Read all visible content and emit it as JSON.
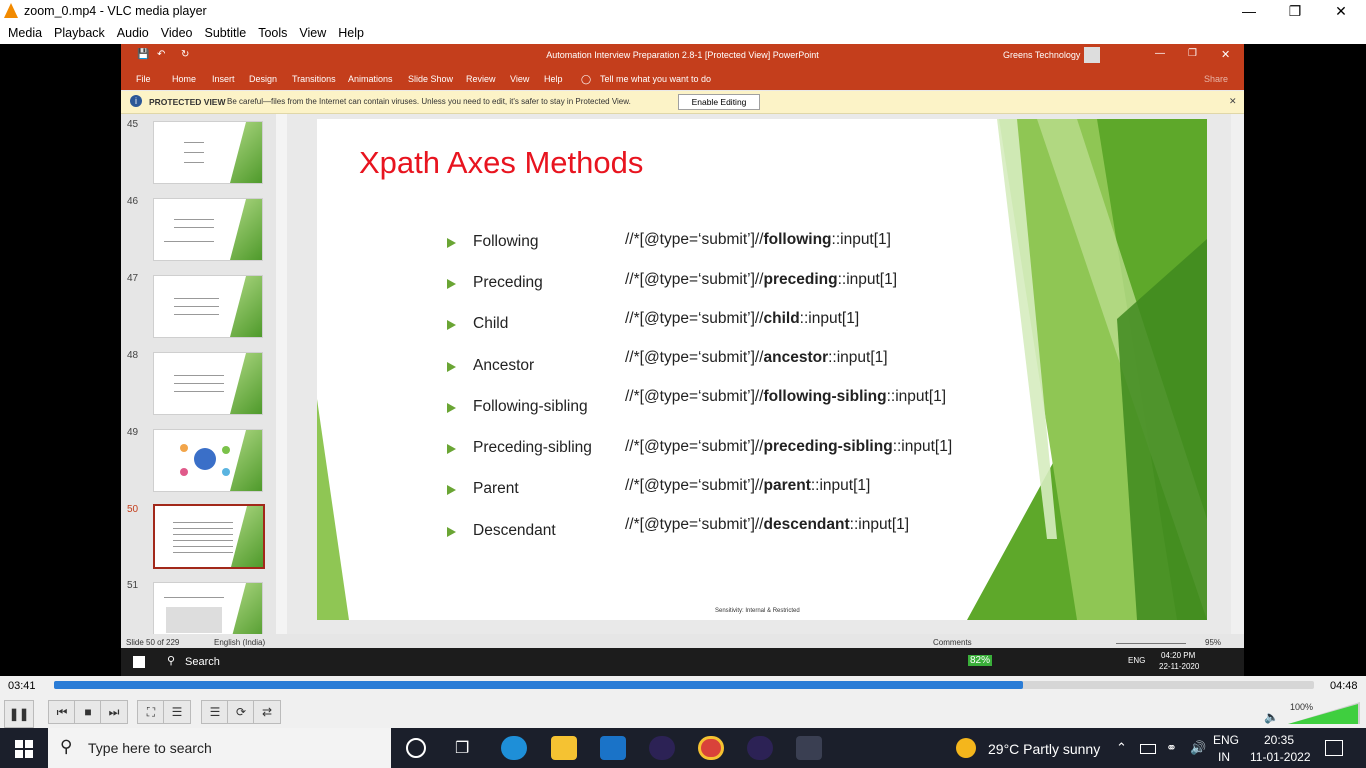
{
  "vlc": {
    "title": "zoom_0.mp4 - VLC media player",
    "menu": [
      "Media",
      "Playback",
      "Audio",
      "Video",
      "Subtitle",
      "Tools",
      "View",
      "Help"
    ],
    "time_elapsed": "03:41",
    "time_total": "04:48",
    "progress_fraction": 0.769,
    "volume": "100%"
  },
  "ppt": {
    "window_title": "Automation Interview Preparation 2.8-1 [Protected View]  PowerPoint",
    "user": "Greens Technology",
    "ribbon_tabs": [
      "File",
      "Home",
      "Insert",
      "Design",
      "Transitions",
      "Animations",
      "Slide Show",
      "Review",
      "View",
      "Help"
    ],
    "tell_me": "Tell me what you want to do",
    "share": "Share",
    "protected_label": "PROTECTED VIEW",
    "protected_msg": "Be careful—files from the Internet can contain viruses. Unless you need to edit, it's safer to stay in Protected View.",
    "enable_editing": "Enable Editing",
    "thumb_numbers": [
      "45",
      "46",
      "47",
      "48",
      "49",
      "50",
      "51"
    ],
    "status_slide": "Slide 50 of 229",
    "status_lang": "English (India)",
    "status_comments": "Comments",
    "zoom": "95%"
  },
  "slide": {
    "title": "Xpath Axes Methods",
    "rows": [
      {
        "name": "Following",
        "pre": "//*[@type=‘submit’]//",
        "kw": "following",
        "post": "::input[1]"
      },
      {
        "name": "Preceding",
        "pre": "//*[@type=‘submit’]//",
        "kw": "preceding",
        "post": "::input[1]"
      },
      {
        "name": "Child",
        "pre": "//*[@type=‘submit’]//",
        "kw": "child",
        "post": "::input[1]"
      },
      {
        "name": "Ancestor",
        "pre": "//*[@type=‘submit’]//",
        "kw": "ancestor",
        "post": "::input[1]"
      },
      {
        "name": "Following-sibling",
        "pre": "//*[@type=‘submit’]//",
        "kw": "following-sibling",
        "post": "::input[1]"
      },
      {
        "name": "Preceding-sibling",
        "pre": "//*[@type=‘submit’]//",
        "kw": "preceding-sibling",
        "post": "::input[1]"
      },
      {
        "name": "Parent",
        "pre": "//*[@type=‘submit’]//",
        "kw": "parent",
        "post": "::input[1]"
      },
      {
        "name": "Descendant",
        "pre": "//*[@type=‘submit’]//",
        "kw": "descendant",
        "post": "::input[1]"
      }
    ],
    "sensitivity": "Sensitivity: Internal & Restricted"
  },
  "inner_taskbar": {
    "search": "Search",
    "battery": "82%",
    "lang": "ENG",
    "time": "04:20 PM",
    "date": "22-11-2020"
  },
  "taskbar": {
    "search_placeholder": "Type here to search",
    "weather": "29°C  Partly sunny",
    "lang1": "ENG",
    "lang2": "IN",
    "time": "20:35",
    "date": "11-01-2022"
  },
  "colors": {
    "ppt_red": "#c43e1c",
    "slide_title": "#e8141f",
    "bullet_green": "#6aa534",
    "vlc_progress": "#2a7cd6"
  }
}
